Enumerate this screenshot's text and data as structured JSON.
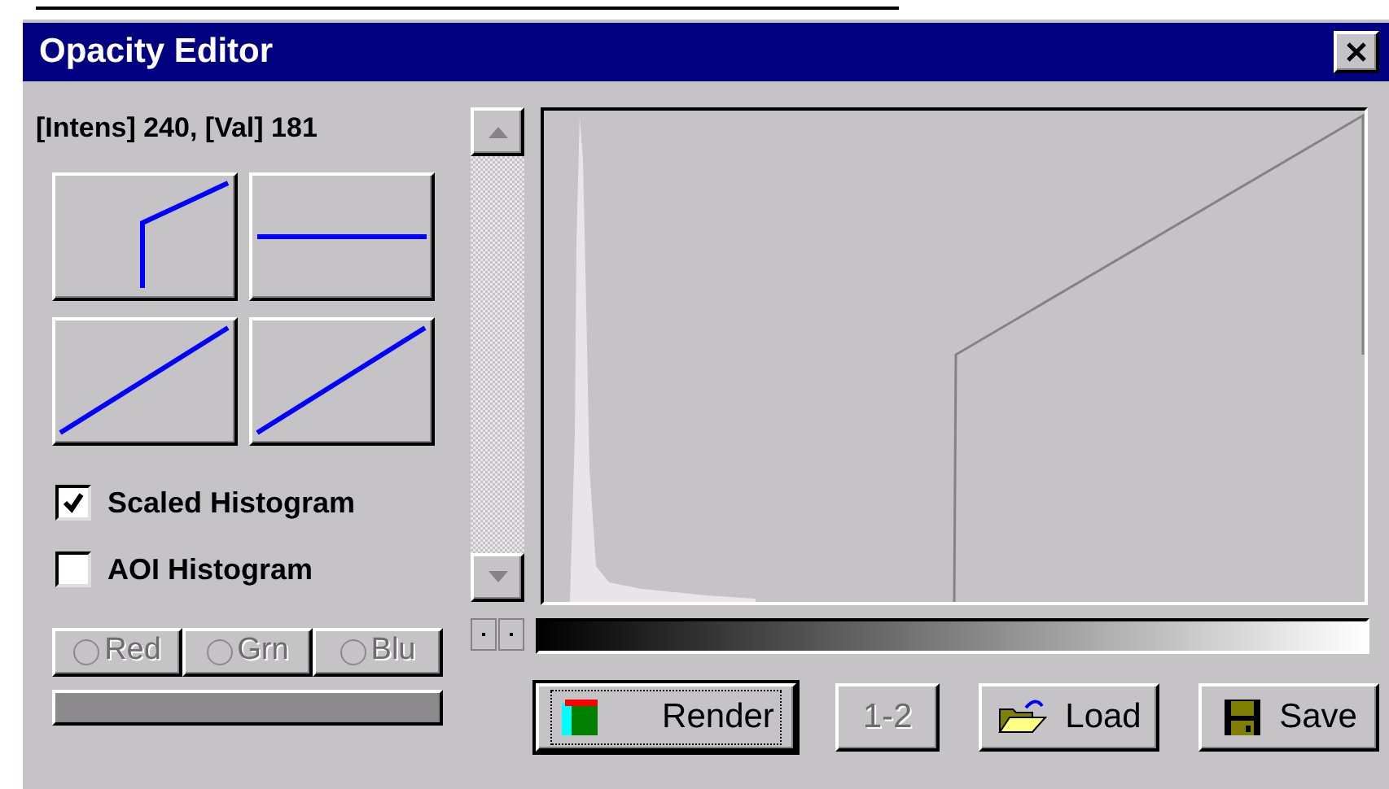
{
  "window": {
    "title": "Opacity Editor"
  },
  "readout": "[Intens] 240, [Val] 181",
  "presets": [
    {
      "kind": "step"
    },
    {
      "kind": "flat"
    },
    {
      "kind": "ramp"
    },
    {
      "kind": "ramp"
    }
  ],
  "checkboxes": [
    {
      "label": "Scaled Histogram",
      "checked": true
    },
    {
      "label": "AOI Histogram",
      "checked": false
    }
  ],
  "channels": [
    {
      "label": "Red",
      "selected": false,
      "disabled": true
    },
    {
      "label": "Grn",
      "selected": false,
      "disabled": true
    },
    {
      "label": "Blu",
      "selected": false,
      "disabled": true
    }
  ],
  "buttons": [
    {
      "label": "Render",
      "kind": "render",
      "focused": true,
      "disabled": false
    },
    {
      "label": "1-2",
      "kind": "plain",
      "focused": false,
      "disabled": true
    },
    {
      "label": "Load",
      "kind": "load",
      "focused": false,
      "disabled": false
    },
    {
      "label": "Save",
      "kind": "save",
      "focused": false,
      "disabled": false
    }
  ]
}
